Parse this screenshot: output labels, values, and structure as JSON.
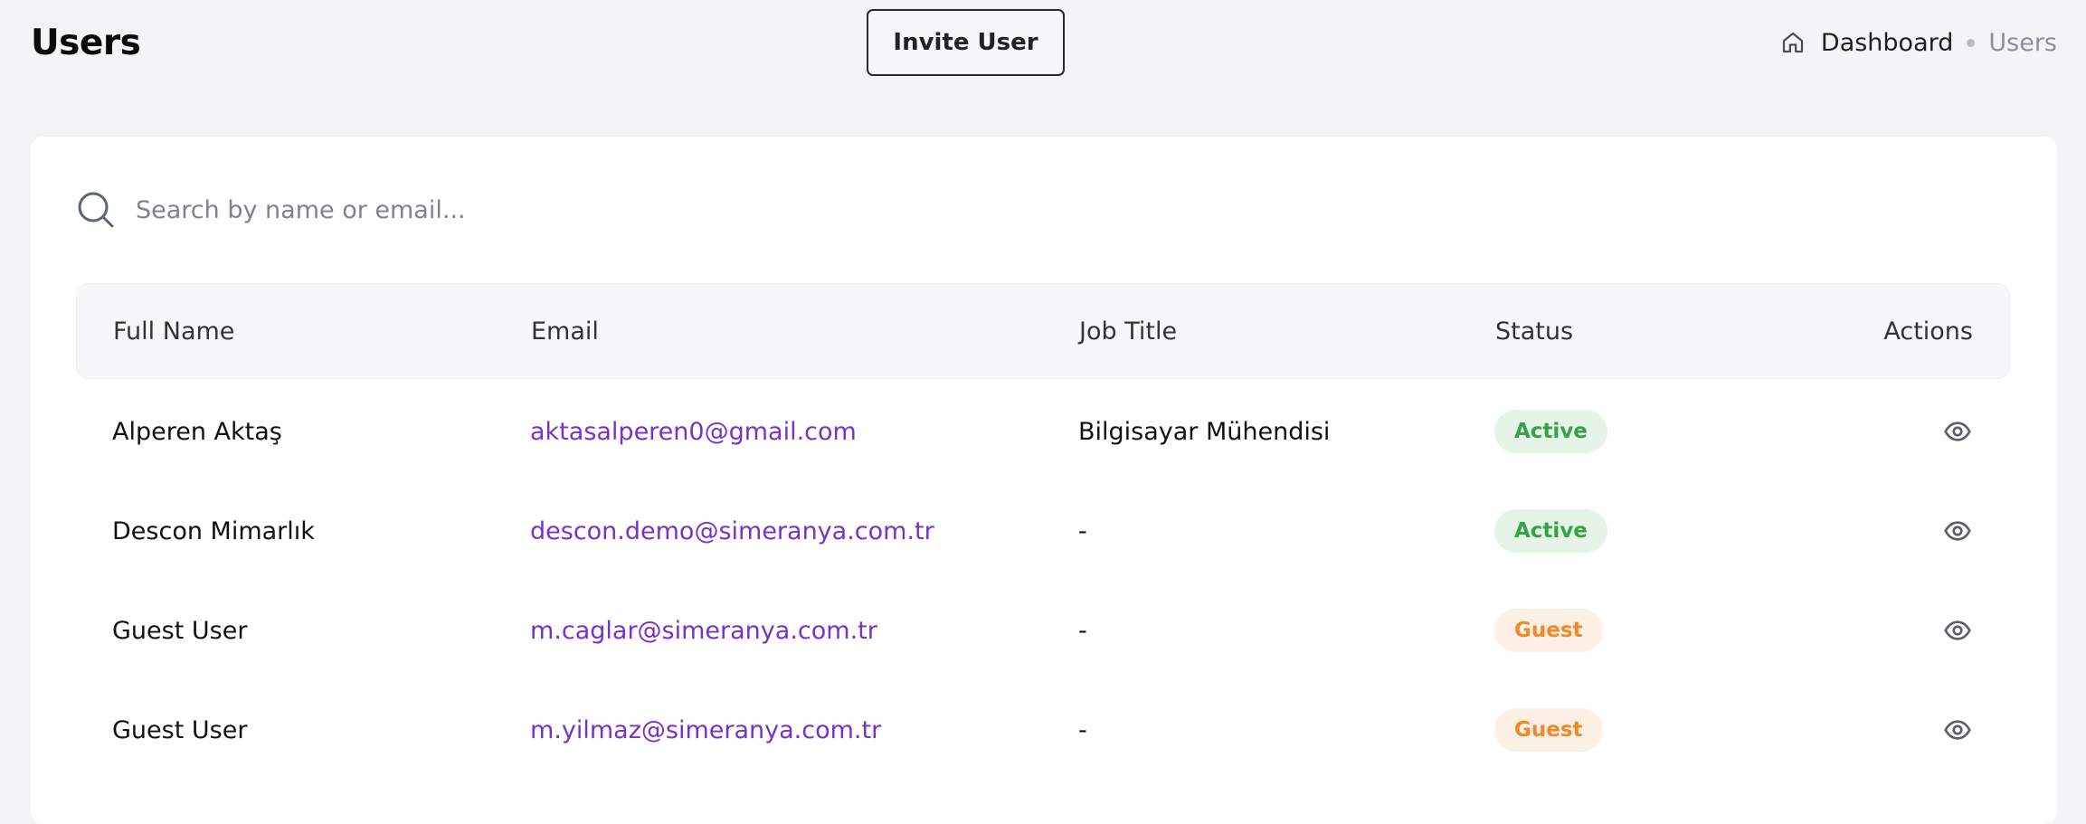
{
  "header": {
    "title": "Users",
    "invite_button_label": "Invite User"
  },
  "breadcrumb": {
    "home_icon": "home-icon",
    "dashboard_label": "Dashboard",
    "current_label": "Users"
  },
  "search": {
    "placeholder": "Search by name or email...",
    "value": "",
    "icon": "search-icon"
  },
  "table": {
    "columns": {
      "full_name": "Full Name",
      "email": "Email",
      "job_title": "Job Title",
      "status": "Status",
      "actions": "Actions"
    },
    "rows": [
      {
        "full_name": "Alperen Aktaş",
        "email": "aktasalperen0@gmail.com",
        "job_title": "Bilgisayar Mühendisi",
        "status": "Active",
        "action_icon": "eye-icon"
      },
      {
        "full_name": "Descon Mimarlık",
        "email": "descon.demo@simeranya.com.tr",
        "job_title": "-",
        "status": "Active",
        "action_icon": "eye-icon"
      },
      {
        "full_name": "Guest User",
        "email": "m.caglar@simeranya.com.tr",
        "job_title": "-",
        "status": "Guest",
        "action_icon": "eye-icon"
      },
      {
        "full_name": "Guest User",
        "email": "m.yilmaz@simeranya.com.tr",
        "job_title": "-",
        "status": "Guest",
        "action_icon": "eye-icon"
      }
    ]
  },
  "colors": {
    "page_background": "#f3f4f6",
    "email_link": "#7a31c9",
    "status_active_text": "#34a348",
    "status_active_bg": "#e6f4e7",
    "status_guest_text": "#ee8a2c",
    "status_guest_bg": "#fcefe3"
  }
}
